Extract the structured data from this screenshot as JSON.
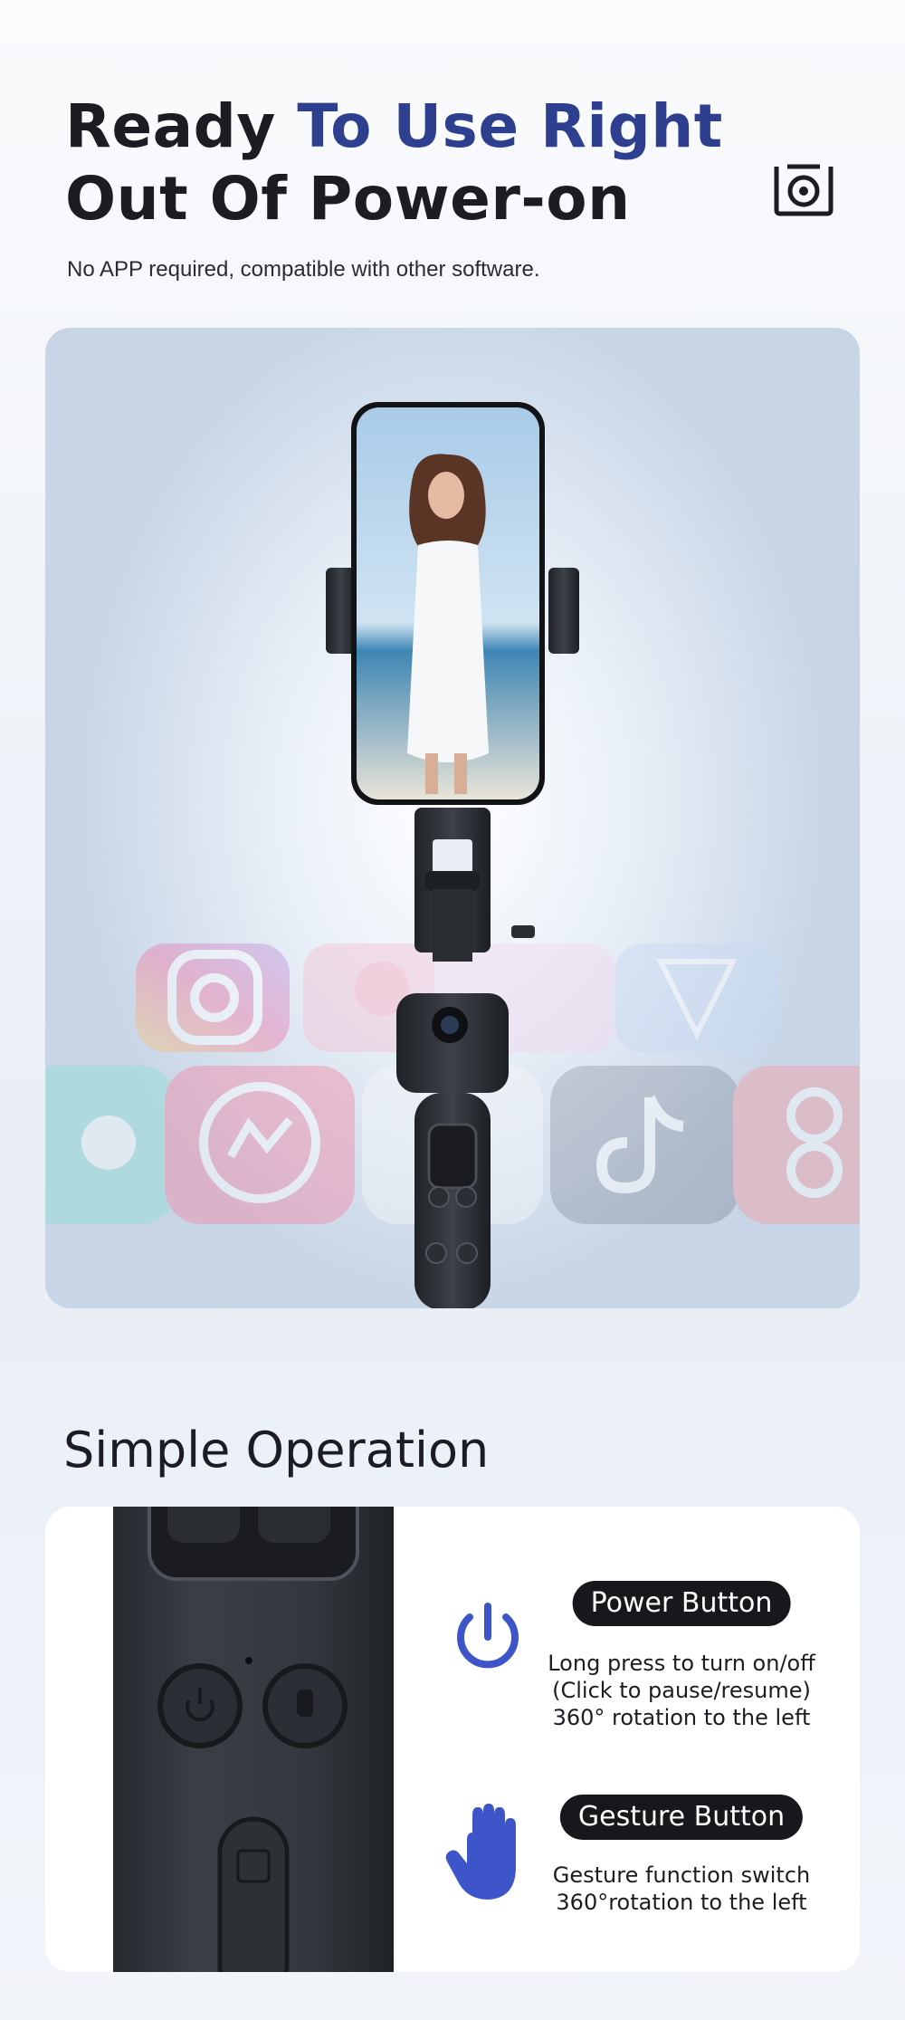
{
  "hero": {
    "title_part1": "Ready ",
    "title_accent": "To Use Right",
    "title_line2": "Out Of Power-on",
    "subtitle": "No APP required, compatible with other software."
  },
  "product_image": {
    "icon": "phone-gimbal-selfie-stick",
    "apps_shown": [
      "instagram-icon",
      "photos-icon",
      "capcut-icon",
      "gallery-icon",
      "messenger-icon",
      "chrome-icon",
      "tiktok-icon",
      "meitu-icon"
    ]
  },
  "operation": {
    "title": "Simple Operation",
    "features": [
      {
        "icon": "power-icon",
        "label": "Power Button",
        "lines": [
          "Long press to turn on/off",
          "(Click to pause/resume)",
          "360° rotation to the left"
        ]
      },
      {
        "icon": "hand-icon",
        "label": "Gesture Button",
        "lines": [
          "Gesture function switch",
          "360°rotation to the left"
        ]
      }
    ]
  },
  "colors": {
    "accent_blue": "#3d55c8",
    "title_accent": "#2f3f8f",
    "pill_bg": "#16181c"
  }
}
